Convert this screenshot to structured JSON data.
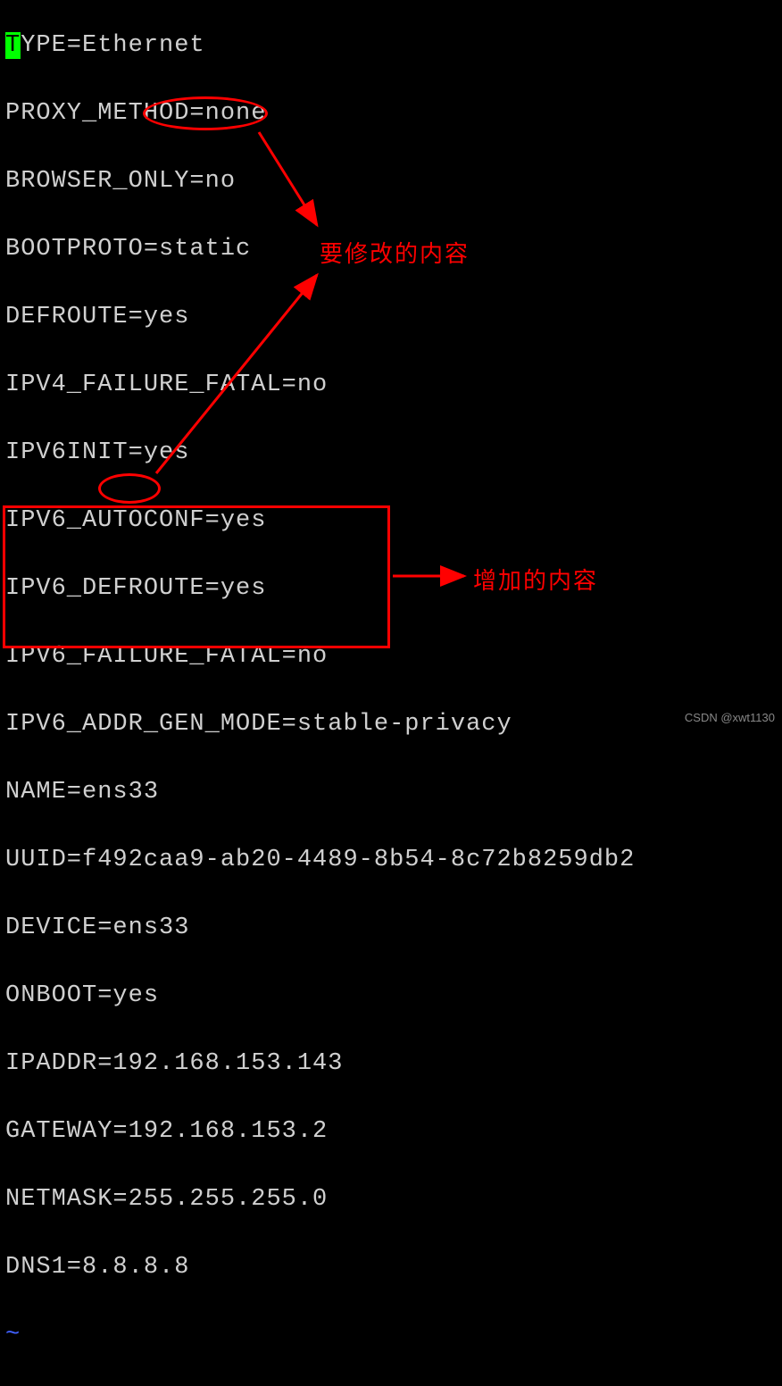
{
  "config": {
    "lines": [
      {
        "text": "TYPE=Ethernet",
        "cursor_first": true
      },
      {
        "text": "PROXY_METHOD=none"
      },
      {
        "text": "BROWSER_ONLY=no"
      },
      {
        "text": "BOOTPROTO=static"
      },
      {
        "text": "DEFROUTE=yes"
      },
      {
        "text": "IPV4_FAILURE_FATAL=no"
      },
      {
        "text": "IPV6INIT=yes"
      },
      {
        "text": "IPV6_AUTOCONF=yes"
      },
      {
        "text": "IPV6_DEFROUTE=yes"
      },
      {
        "text": "IPV6_FAILURE_FATAL=no"
      },
      {
        "text": "IPV6_ADDR_GEN_MODE=stable-privacy"
      },
      {
        "text": "NAME=ens33"
      },
      {
        "text": "UUID=f492caa9-ab20-4489-8b54-8c72b8259db2"
      },
      {
        "text": "DEVICE=ens33"
      },
      {
        "text": "ONBOOT=yes"
      },
      {
        "text": "IPADDR=192.168.153.143"
      },
      {
        "text": "GATEWAY=192.168.153.2"
      },
      {
        "text": "NETMASK=255.255.255.0"
      },
      {
        "text": "DNS1=8.8.8.8"
      }
    ],
    "tilde": "~"
  },
  "annotations": {
    "modify_label": "要修改的内容",
    "add_label": "增加的内容"
  },
  "watermark": {
    "text": "CSDN @xwt1130",
    "faint": ""
  }
}
